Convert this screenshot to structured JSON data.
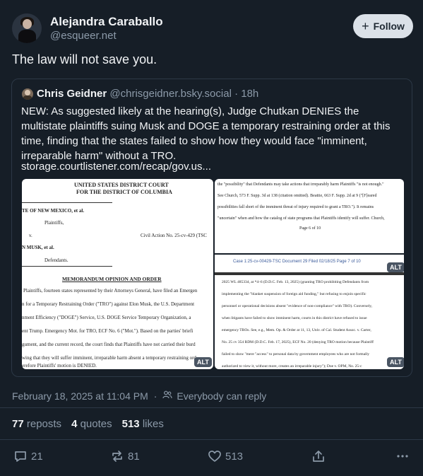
{
  "author": {
    "name": "Alejandra Caraballo",
    "handle": "@esqueer.net",
    "follow_label": "Follow"
  },
  "post": {
    "text": "The law will not save you.",
    "timestamp": "February 18, 2025 at 11:04 PM",
    "reply_setting": "Everybody can reply"
  },
  "quote": {
    "name": "Chris Geidner",
    "handle": "@chrisgeidner.bsky.social",
    "age": "18h",
    "text": "NEW: As suggested likely at the hearing(s), Judge Chutkan DENIES the multistate plaintiffs suing Musk and DOGE a temporary restraining order at this time, finding that the states failed to show how they would face \"imminent, irreparable harm\" without a TRO.",
    "link": "storage.courtlistener.com/recap/gov.us...",
    "alt_label": "ALT",
    "doc1": {
      "court1": "UNITED STATES DISTRICT COURT",
      "court2": "FOR THE DISTRICT OF COLUMBIA",
      "party1": "TE OF NEW MEXICO, et al.",
      "plaintiffs": "Plaintiffs,",
      "v": "v.",
      "civil_action": "Civil Action No. 25-cv-429 (TSC",
      "party2": "N MUSK, et al.",
      "defendants": "Defendants.",
      "heading": "MEMORANDUM OPINION AND ORDER",
      "lines": [
        "Plaintiffs, fourteen states represented by their Attorneys General, have filed an Emergen",
        "n for a Temporary Restraining Order (\"TRO\") against Elon Musk, the U.S. Department",
        "nment Efficiency (\"DOGE\") Service, U.S. DOGE Service Temporary Organization, a",
        "ent Trump.  Emergency Mot. for TRO, ECF No. 6 (\"Mot.\").  Based on the parties' briefi",
        "gument, and the current record, the court finds that Plaintiffs have not carried their burd",
        "wing that they will suffer imminent, irreparable harm absent a temporary restraining ord",
        "erefore Plaintiffs' motion is DENIED."
      ]
    },
    "doc2": {
      "lines": [
        "the \"possibility\" that Defendants may take actions that irreparably harm Plaintiffs \"is not enough.\"",
        "See Church, 573 F. Supp. 3d at 138 (citation omitted). Beattie, 663 F. Supp. 2d at 9 (\"[F]eared",
        "possibilities fall short of the imminent threat of injury required to grant a TRO.\").  It remains",
        "\"uncertain\" when and how the catalog of state programs that Plaintiffs identify will suffer.  Church,"
      ],
      "page": "Page 6 of 10"
    },
    "doc3": {
      "header": "Case 1:25-cv-00429-TSC     Document 29     Filed 02/18/25     Page 7 of 10",
      "lines": [
        "2025 WL 485334, at *4–6 (D.D.C. Feb. 13, 2025) (granting TRO prohibiting Defendants from",
        "implementing the \"blanket suspension of foreign aid funding,\" but refusing to enjoin specific",
        "personnel or operational decisions absent \"evidence of non-compliance\" with TRO).  Conversely,",
        "when litigants have failed to show imminent harm, courts in this district have refused to issue",
        "emergency TROs.  See, e.g., Mem. Op. & Order at 11, 13, Univ. of Cal. Student Assoc. v. Carter,",
        "No. 25 cv 354 RDM (D.D.C. Feb. 17, 2025), ECF No. 20 (denying TRO motion because Plaintiff",
        "failed to show \"mere \"access\" to personal data by government employees who are not formally",
        "authorized to view it, without more, creates an irreparable injury\"); Doe v. OPM, No. 25-c"
      ]
    }
  },
  "stats": {
    "reposts_count": "77",
    "reposts_label": "reposts",
    "quotes_count": "4",
    "quotes_label": "quotes",
    "likes_count": "513",
    "likes_label": "likes"
  },
  "actions": {
    "replies": "21",
    "reposts": "81",
    "likes": "513"
  },
  "colors": {
    "background": "#161e27",
    "muted_text": "#8c9aa9",
    "follow_button_bg": "#dbe1e8"
  }
}
